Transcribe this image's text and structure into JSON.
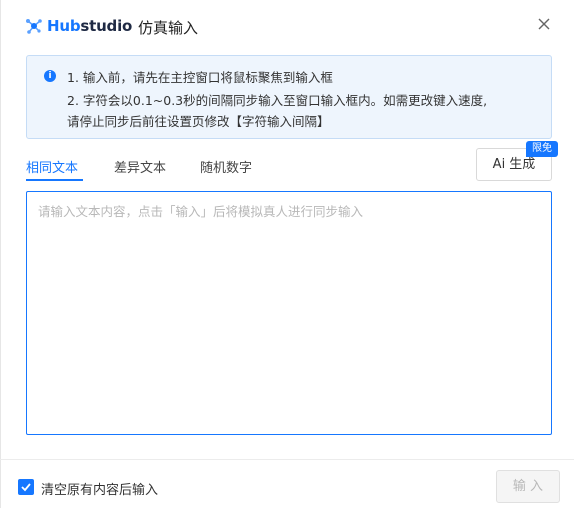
{
  "header": {
    "brand_prefix": "Hub",
    "brand_suffix": "studio",
    "title": "仿真输入",
    "logo_icon": "hubstudio-logo-icon",
    "close_icon": "close-icon"
  },
  "info": {
    "icon": "info-icon",
    "icon_glyph": "i",
    "line1": "1. 输入前，请先在主控窗口将鼠标聚焦到输入框",
    "line2": "2. 字符会以0.1~0.3秒的间隔同步输入至窗口输入框内。如需更改键入速度,",
    "line3": "请停止同步后前往设置页修改【字符输入间隔】"
  },
  "tabs": [
    {
      "label": "相同文本",
      "active": true
    },
    {
      "label": "差异文本",
      "active": false
    },
    {
      "label": "随机数字",
      "active": false
    }
  ],
  "ai_button": {
    "label": "Ai 生成",
    "badge": "限免"
  },
  "textarea": {
    "value": "",
    "placeholder": "请输入文本内容，点击「输入」后将模拟真人进行同步输入"
  },
  "footer": {
    "checkbox_label": "清空原有内容后输入",
    "checkbox_checked": true,
    "submit_label": "输 入"
  },
  "colors": {
    "accent": "#1677ff",
    "info_bg": "#eef5fd",
    "info_border": "#c5dcf6"
  }
}
